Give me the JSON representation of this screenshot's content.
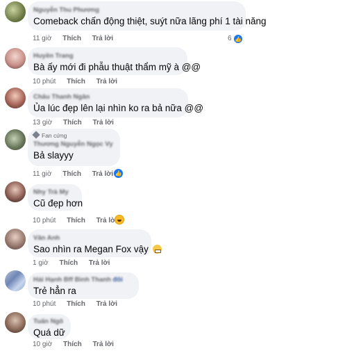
{
  "comments": [
    {
      "author": "Nguyễn Thu Phương",
      "text": "Comeback chấn động thiệt, suýt nữa lãng phí 1 tài năng",
      "time": "11 giờ",
      "like": "Thích",
      "reply": "Trả lời",
      "reactions": "6"
    },
    {
      "author": "Huyền Trang",
      "text": "Bà ấy mới đi phẫu thuật thẩm mỹ à @@",
      "time": "10 phút",
      "like": "Thích",
      "reply": "Trả lời"
    },
    {
      "author": "Châu Thanh Ngân",
      "text": "Ủa lúc đẹp lên lại nhìn ko ra bả nữa @@",
      "time": "13 giờ",
      "like": "Thích",
      "reply": "Trả lời"
    },
    {
      "badge": "Fan cứng",
      "author": "Thương Nguyễn Ngọc Vy",
      "text": "Bả slayyy",
      "time": "11 giờ",
      "like": "Thích",
      "reply": "Trả lời"
    },
    {
      "author": "Nhy Trà My",
      "text": "Cũ đẹp hơn",
      "time": "10 phút",
      "like": "Thích",
      "reply": "Trả lời"
    },
    {
      "author": "Văn Anh",
      "text": "Sao nhìn ra Megan Fox vậy",
      "time": "1 giờ",
      "like": "Thích",
      "reply": "Trả lời"
    },
    {
      "author": "Hải Hạnh Bff Bình Thanh",
      "author_suffix": "đôi",
      "text": "Trẻ hẳn ra",
      "time": "10 phút",
      "like": "Thích",
      "reply": "Trả lời"
    },
    {
      "author": "Tuấn Ngô",
      "text": "Quá dữ",
      "time": "10 giờ",
      "like": "Thích",
      "reply": "Trả lời"
    }
  ],
  "colors": {
    "bubble": "#f0f2f5",
    "meta": "#65676b",
    "like_blue": "#1877f2"
  }
}
